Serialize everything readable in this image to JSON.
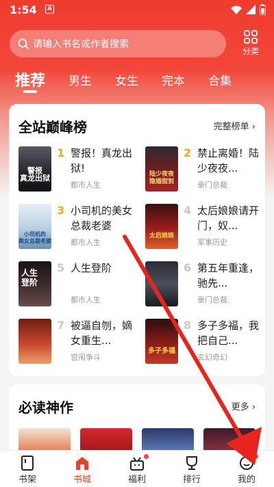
{
  "status_bar": {
    "time": "1:54",
    "notif_icon": "A"
  },
  "search": {
    "placeholder": "请输入书名或作者搜索"
  },
  "category_label": "分类",
  "tabs": [
    "推荐",
    "男生",
    "女生",
    "完本",
    "合集"
  ],
  "ranking": {
    "title": "全站巅峰榜",
    "more": "完整榜单",
    "books": [
      {
        "rank": "1",
        "title": "警报！真龙出狱!",
        "category": "都市人生",
        "cover_text": "警报\n真龙出狱"
      },
      {
        "rank": "2",
        "title": "禁止离婚！陆少夜夜...",
        "category": "豪门总裁",
        "cover_text": "陆少夜夜\n隐婚甜到"
      },
      {
        "rank": "3",
        "title": "小司机的美女总裁老婆",
        "category": "都市人生",
        "cover_text": "小司机的\n美女总裁老婆"
      },
      {
        "rank": "4",
        "title": "太后娘娘请开门，奴...",
        "category": "军事历史",
        "cover_text": "太后娘娘"
      },
      {
        "rank": "5",
        "title": "人生登阶",
        "category": "都市人生",
        "cover_text": "人生\n登阶"
      },
      {
        "rank": "6",
        "title": "第五年重逢，驰先...",
        "category": "豪门总裁",
        "cover_text": ""
      },
      {
        "rank": "7",
        "title": "被逼自刎，嫡女重生...",
        "category": "宫闱争斗",
        "cover_text": ""
      },
      {
        "rank": "8",
        "title": "多子多福，我把自己...",
        "category": "玄幻奇幻",
        "cover_text": "多子多福"
      }
    ]
  },
  "must_read": {
    "title": "必读神作",
    "more": "更多"
  },
  "bottom_nav": [
    "书架",
    "书城",
    "福利",
    "排行",
    "我的"
  ],
  "colors": {
    "brand_red": "#f03b2f",
    "rank_gold": "#f5a623",
    "rank_gray": "#c8c8c8",
    "arrow_red": "#e8251d"
  }
}
